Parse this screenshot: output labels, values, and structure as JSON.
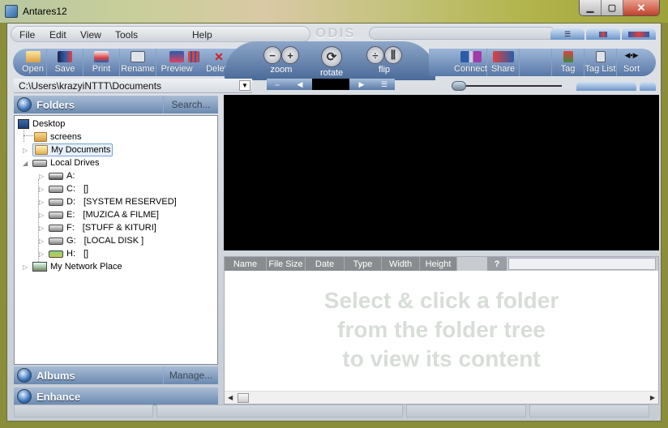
{
  "window": {
    "title": "Antares12",
    "controls": [
      "minimize",
      "maximize",
      "close"
    ]
  },
  "menu": {
    "items": [
      "File",
      "Edit",
      "View",
      "Tools",
      "Help"
    ],
    "brand": "ODIS"
  },
  "toolbar": {
    "left": [
      {
        "label": "Open",
        "icon": "open-folder-icon"
      },
      {
        "label": "Save",
        "icon": "save-disk-icon"
      },
      {
        "label": "Print",
        "icon": "printer-icon"
      },
      {
        "label": "Rename",
        "icon": "rename-icon"
      },
      {
        "label": "Preview",
        "icon": "preview-icon"
      },
      {
        "label": "",
        "icon": "thumbnails-icon"
      },
      {
        "label": "Delete",
        "icon": "delete-x-icon"
      }
    ],
    "center": [
      {
        "label": "zoom",
        "buttons": [
          "−",
          "+"
        ]
      },
      {
        "label": "rotate",
        "buttons": [
          "⟳"
        ]
      },
      {
        "label": "flip",
        "buttons": [
          "÷",
          "⫼"
        ]
      }
    ],
    "right": [
      {
        "label": "Connect",
        "icon": "connect-icon"
      },
      {
        "label": "Share",
        "icon": "share-icon"
      },
      {
        "label": "",
        "icon": "blank"
      },
      {
        "label": "Tag",
        "icon": "tag-add-icon"
      },
      {
        "label": "Tag List",
        "icon": "tag-list-icon"
      },
      {
        "label": "Sort",
        "icon": "sort-icon"
      }
    ]
  },
  "path": {
    "value": "C:\\Users\\krazyiNTTT\\Documents"
  },
  "nav": {
    "swap": "⇔",
    "prev": "◀",
    "next": "▶",
    "list": "☰"
  },
  "folders_panel": {
    "title": "Folders",
    "action": "Search..."
  },
  "albums_panel": {
    "title": "Albums",
    "action": "Manage..."
  },
  "enhance_panel": {
    "title": "Enhance"
  },
  "tree": {
    "desktop": "Desktop",
    "screens": "screens",
    "my_documents": "My Documents",
    "local_drives": "Local Drives",
    "drives": [
      {
        "letter": "A:",
        "label": ""
      },
      {
        "letter": "C:",
        "label": "[]"
      },
      {
        "letter": "D:",
        "label": "[SYSTEM RESERVED]"
      },
      {
        "letter": "E:",
        "label": "[MUZICA & FILME]"
      },
      {
        "letter": "F:",
        "label": "[STUFF & KITURI]"
      },
      {
        "letter": "G:",
        "label": "[LOCAL DISK ]"
      },
      {
        "letter": "H:",
        "label": "[]"
      }
    ],
    "network": "My Network Place"
  },
  "columns": [
    "Name",
    "File Size",
    "Date",
    "Type",
    "Width",
    "Height"
  ],
  "help_btn": "?",
  "message": [
    "Select & click a folder",
    "from the folder tree",
    "to view its content"
  ]
}
